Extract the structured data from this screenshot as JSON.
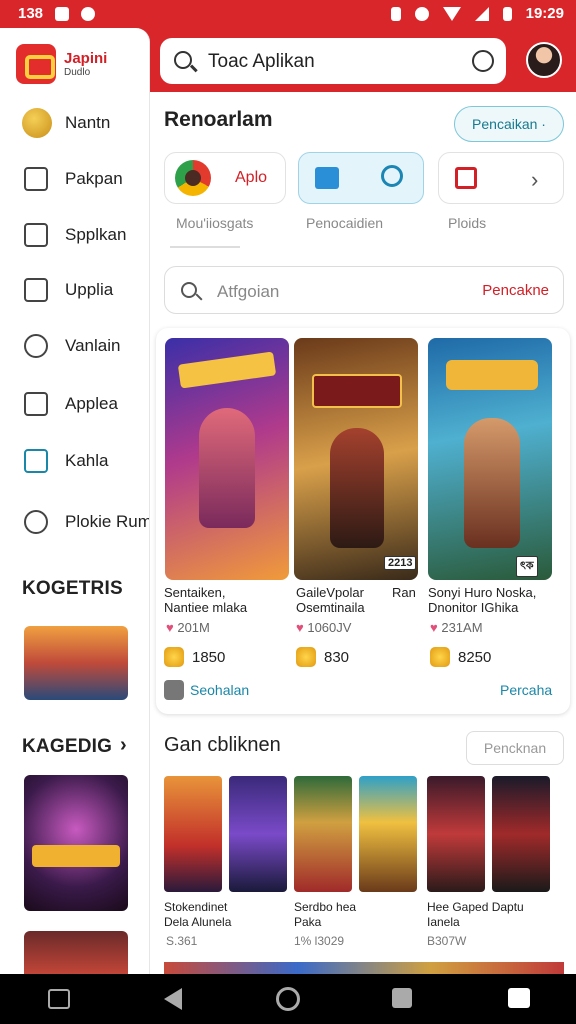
{
  "status_bar": {
    "time_left": "138",
    "time_right": "19:29"
  },
  "search": {
    "placeholder": "Toac Aplikan"
  },
  "sidebar": {
    "brand_name": "Japini",
    "brand_sub": "Dudlo",
    "items": [
      {
        "label": "Nantn",
        "icon": "coin-icon"
      },
      {
        "label": "Pakpan",
        "icon": "calendar-icon"
      },
      {
        "label": "Spplkan",
        "icon": "document-icon"
      },
      {
        "label": "Upplia",
        "icon": "grid-icon"
      },
      {
        "label": "Vanlain",
        "icon": "clock-icon"
      },
      {
        "label": "Applea",
        "icon": "file-icon"
      },
      {
        "label": "Kahla",
        "icon": "monitor-icon"
      },
      {
        "label": "Plokie Rumi",
        "icon": "tag-icon"
      }
    ],
    "section1": "KOGETRIS",
    "section2": "KAGEDIG",
    "section2_chevron": "›"
  },
  "main": {
    "title": "Renoarlam",
    "pill": "Pencaikan ·",
    "categories": [
      {
        "label": "Aplo",
        "caption": "Mou'iiosgats"
      },
      {
        "label": "",
        "caption": "Penocaidien"
      },
      {
        "label": "",
        "caption": "Ploids"
      }
    ],
    "search2_placeholder": "Atfgoian",
    "search2_action": "Pencakne",
    "games": [
      {
        "title": "Sentaiken,\nNantiee mlaka",
        "stat": "201M",
        "price": "1850",
        "badge": ""
      },
      {
        "title": "GaileVpolar\nOsemtinaila",
        "title_extra": "Ran",
        "stat": "1060JV",
        "price": "830",
        "badge": "2213"
      },
      {
        "title": "Sonyi Huro Noska,\nDnonitor IGhika",
        "stat": "231AM",
        "price": "8250",
        "badge": "ৎক"
      }
    ],
    "card_footer_left": "Seohalan",
    "card_footer_right": "Percaha",
    "section2_title": "Gan cbliknen",
    "section2_pill": "Pencknan",
    "more_games": [
      {
        "title": "Stokendinet\nDela Alunela",
        "stat": "S.361"
      },
      {
        "title": "Serdbo hea\nPaka",
        "stat": "1% l3029"
      },
      {
        "title": "Hee Gaped Daptu\nIanela",
        "stat": "B307W"
      }
    ]
  },
  "colors": {
    "accent": "#d9262b",
    "link": "#1a87a8"
  }
}
